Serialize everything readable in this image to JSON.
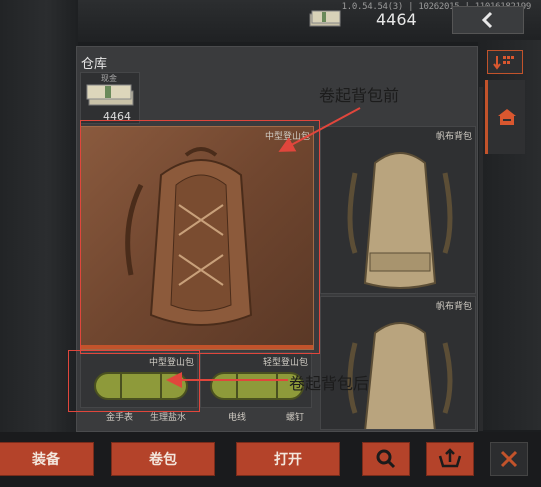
{
  "header": {
    "version": "1.0.54.54(3) | 10262015 | 11016182199",
    "money": "4464",
    "money_icon": "cash-icon",
    "back_icon": "chevron-left-icon"
  },
  "warehouse": {
    "title": "仓库",
    "sort_icon": "sort-down-icon",
    "side_tab_icon": "house-icon",
    "items": [
      {
        "name": "纸币",
        "qty": "4464",
        "caption": "现金"
      },
      {
        "label": "中型登山包",
        "progress": 1.0
      },
      {
        "label": "帆布背包"
      },
      {
        "label": "帆布背包"
      },
      {
        "label": "中型登山包"
      },
      {
        "label": "轻型登山包"
      }
    ],
    "bottom_labels": [
      "金手表",
      "生理盐水",
      "电线",
      "螺钉"
    ]
  },
  "annotations": {
    "before": "卷起背包前",
    "after": "卷起背包后",
    "color": "#e0463c"
  },
  "toolbar": {
    "equip": "装备",
    "roll": "卷包",
    "open": "打开",
    "search_icon": "search-icon",
    "cart_icon": "sell-icon",
    "close_icon": "close-icon",
    "accent": "#b4432a"
  }
}
